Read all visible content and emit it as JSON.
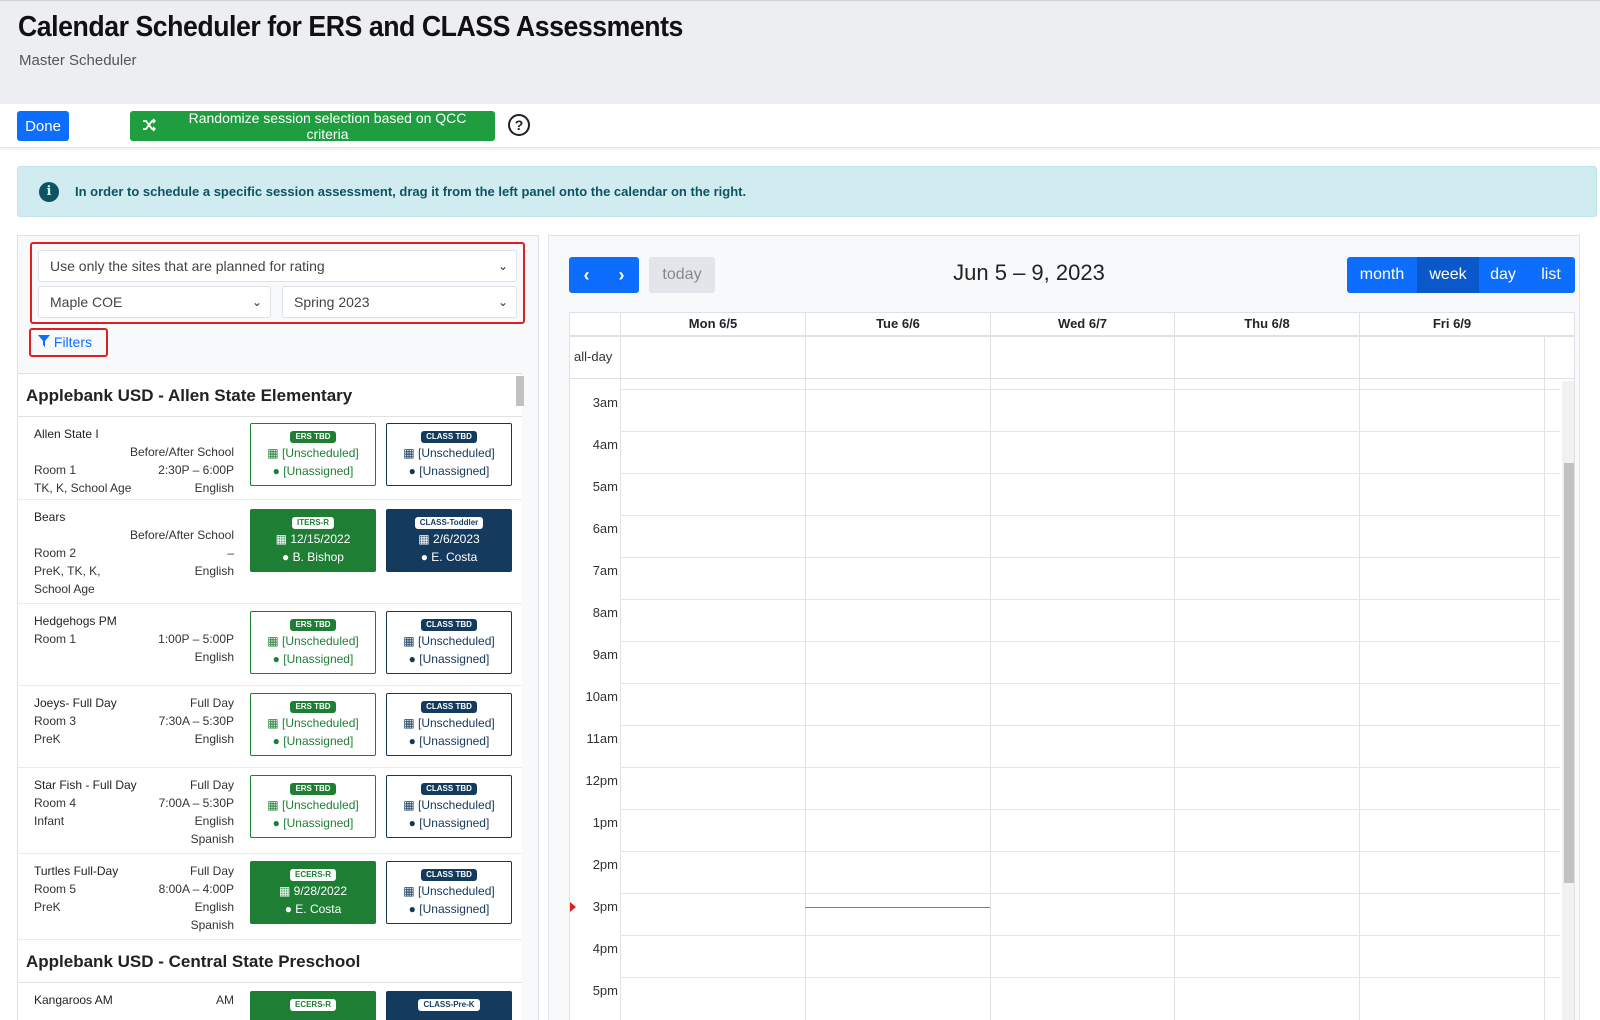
{
  "header": {
    "title": "Calendar Scheduler for ERS and CLASS Assessments",
    "subtitle": "Master Scheduler"
  },
  "toolbar": {
    "done_label": "Done",
    "randomize_label": "Randomize session selection based on QCC criteria",
    "help_symbol": "?"
  },
  "alert": {
    "icon": "i",
    "text": "In order to schedule a specific session assessment, drag it from the left panel onto the calendar on the right."
  },
  "filters": {
    "site_mode": "Use only the sites that are planned for rating",
    "agency": "Maple COE",
    "term": "Spring 2023",
    "filters_label": "Filters"
  },
  "sites": [
    {
      "name": "Applebank USD - Allen State Elementary",
      "classes": [
        {
          "name": "Allen State I",
          "schedule": "Before/After School",
          "room": "Room 1",
          "time": "2:30P – 6:00P",
          "ages": "TK, K, School Age",
          "language": "English",
          "ers": {
            "badge": "ERS TBD",
            "date": "[Unscheduled]",
            "assessor": "[Unassigned]"
          },
          "class": {
            "badge": "CLASS TBD",
            "date": "[Unscheduled]",
            "assessor": "[Unassigned]"
          }
        },
        {
          "name": "Bears",
          "schedule": "Before/After School",
          "room": "Room 2",
          "time": "–",
          "ages": "PreK, TK, K,",
          "ages2": "School Age",
          "language": "English",
          "ers": {
            "badge": "ITERS-R",
            "date": "12/15/2022",
            "assessor": "B. Bishop"
          },
          "class": {
            "badge": "CLASS-Toddler",
            "date": "2/6/2023",
            "assessor": "E. Costa"
          }
        },
        {
          "name": "Hedgehogs PM",
          "room": "Room 1",
          "time": "1:00P – 5:00P",
          "language": "English",
          "ers": {
            "badge": "ERS TBD",
            "date": "[Unscheduled]",
            "assessor": "[Unassigned]"
          },
          "class": {
            "badge": "CLASS TBD",
            "date": "[Unscheduled]",
            "assessor": "[Unassigned]"
          }
        },
        {
          "name": "Joeys- Full Day",
          "schedule": "Full Day",
          "room": "Room 3",
          "time": "7:30A – 5:30P",
          "ages": "PreK",
          "language": "English",
          "ers": {
            "badge": "ERS TBD",
            "date": "[Unscheduled]",
            "assessor": "[Unassigned]"
          },
          "class": {
            "badge": "CLASS TBD",
            "date": "[Unscheduled]",
            "assessor": "[Unassigned]"
          }
        },
        {
          "name": "Star Fish - Full Day",
          "schedule": "Full Day",
          "room": "Room 4",
          "time": "7:00A – 5:30P",
          "ages": "Infant",
          "language": "English",
          "language2": "Spanish",
          "ers": {
            "badge": "ERS TBD",
            "date": "[Unscheduled]",
            "assessor": "[Unassigned]"
          },
          "class": {
            "badge": "CLASS TBD",
            "date": "[Unscheduled]",
            "assessor": "[Unassigned]"
          }
        },
        {
          "name": "Turtles Full-Day",
          "schedule": "Full Day",
          "room": "Room 5",
          "time": "8:00A – 4:00P",
          "ages": "PreK",
          "language": "English",
          "language2": "Spanish",
          "ers": {
            "badge": "ECERS-R",
            "date": "9/28/2022",
            "assessor": "E. Costa"
          },
          "class": {
            "badge": "CLASS TBD",
            "date": "[Unscheduled]",
            "assessor": "[Unassigned]"
          }
        }
      ]
    },
    {
      "name": "Applebank USD - Central State Preschool",
      "classes": [
        {
          "name": "Kangaroos AM",
          "schedule": "AM",
          "ers": {
            "badge": "ECERS-R"
          },
          "class": {
            "badge": "CLASS-Pre-K"
          }
        }
      ]
    }
  ],
  "calendar": {
    "title": "Jun 5 – 9, 2023",
    "today_label": "today",
    "prev_icon": "chevron-left-icon",
    "next_icon": "chevron-right-icon",
    "views": [
      "month",
      "week",
      "day",
      "list"
    ],
    "active_view": "week",
    "days": [
      "Mon 6/5",
      "Tue 6/6",
      "Wed 6/7",
      "Thu 6/8",
      "Fri 6/9"
    ],
    "allday_label": "all-day",
    "hours": [
      "3am",
      "4am",
      "5am",
      "6am",
      "7am",
      "8am",
      "9am",
      "10am",
      "11am",
      "12pm",
      "1pm",
      "2pm",
      "3pm",
      "4pm",
      "5pm"
    ]
  },
  "colors": {
    "primary": "#0d6efd",
    "success": "#1e9e3e",
    "ers_green": "#1e7e34",
    "class_navy": "#143a5e",
    "highlight_red": "#e02020",
    "info_bg": "#d1ecf1"
  }
}
